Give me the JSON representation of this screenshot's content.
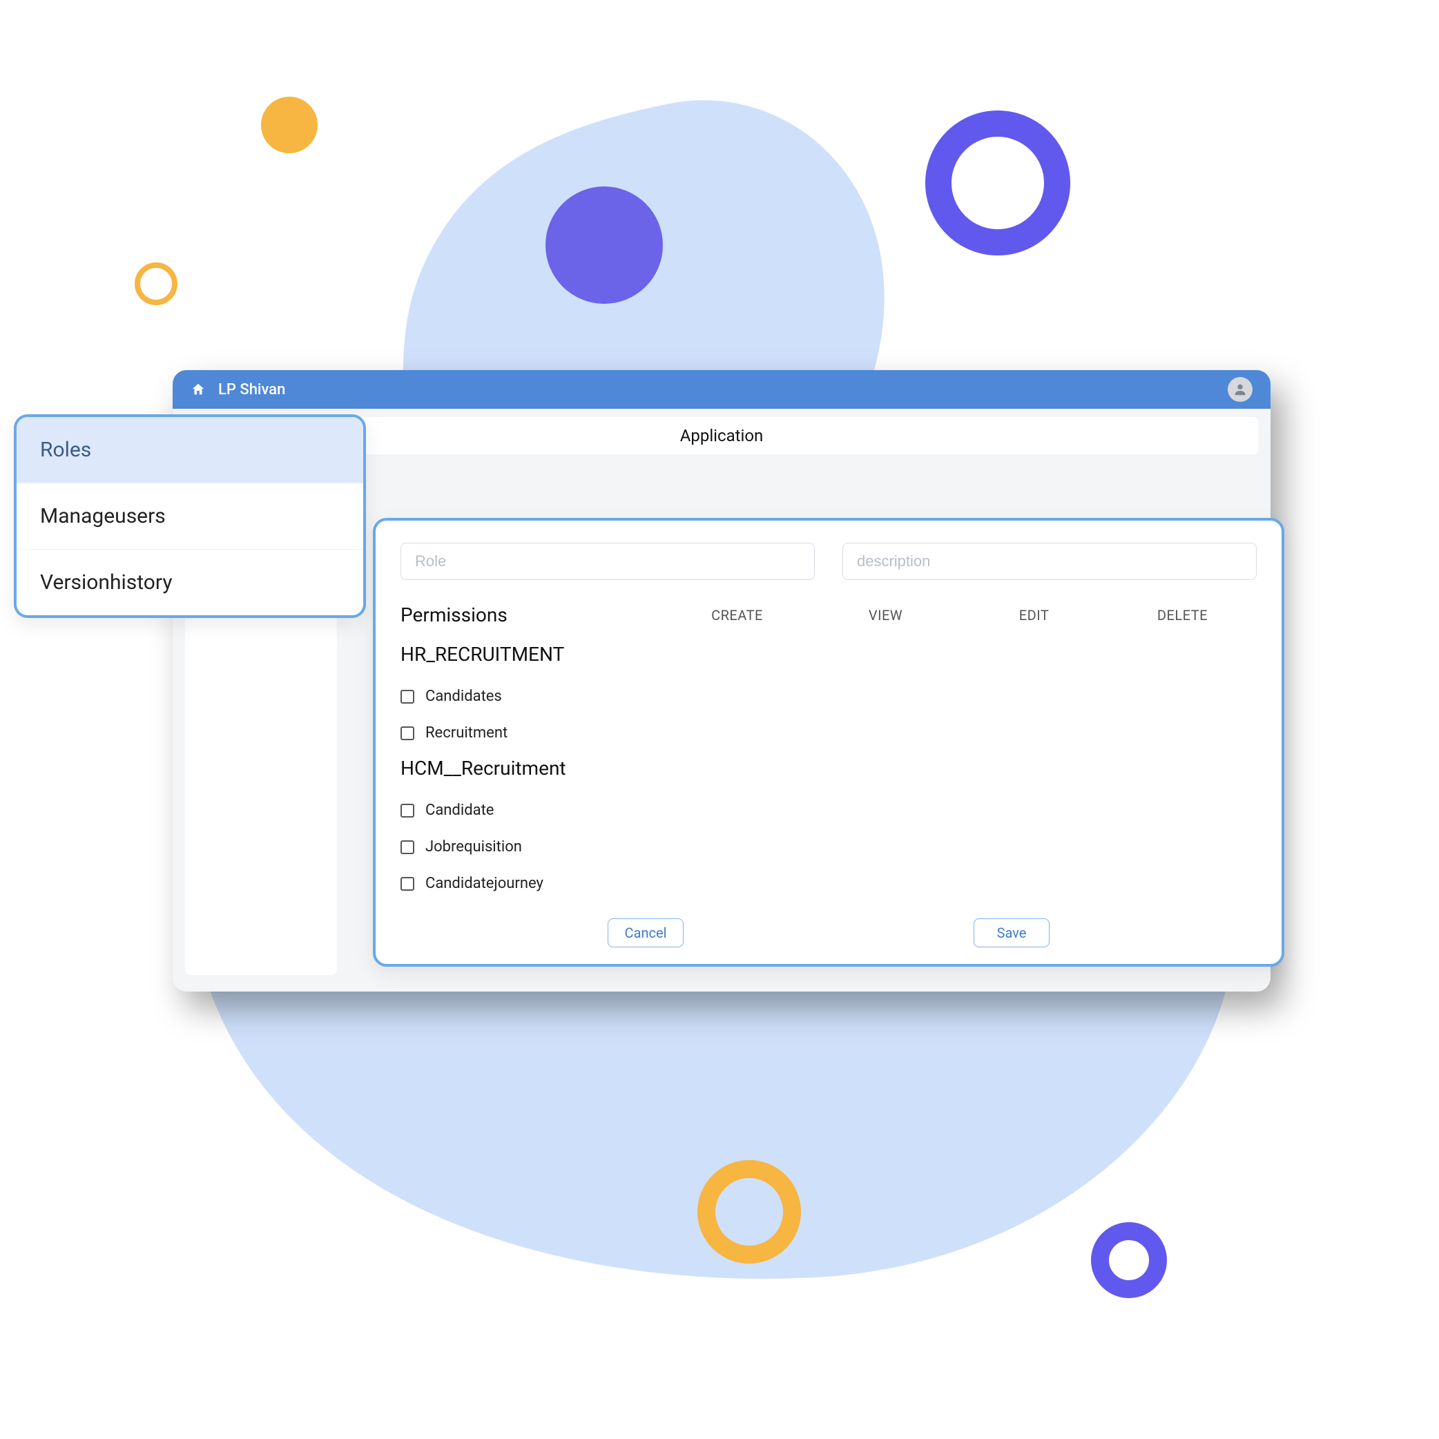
{
  "decor": {},
  "header": {
    "user_name": "LP Shivan",
    "subtitle": "Application"
  },
  "sidebar": {
    "items": [
      {
        "label": "Roles",
        "active": true
      },
      {
        "label": "Manageusers",
        "active": false
      },
      {
        "label": "Versionhistory",
        "active": false
      }
    ]
  },
  "form": {
    "role_placeholder": "Role",
    "description_placeholder": "description",
    "permissions_title": "Permissions",
    "columns": {
      "create": "CREATE",
      "view": "VIEW",
      "edit": "EDIT",
      "delete": "DELETE"
    },
    "groups": [
      {
        "title": "HR_RECRUITMENT",
        "items": [
          {
            "label": "Candidates"
          },
          {
            "label": "Recruitment"
          }
        ]
      },
      {
        "title": "HCM__Recruitment",
        "items": [
          {
            "label": "Candidate"
          },
          {
            "label": "Jobrequisition"
          },
          {
            "label": "Candidatejourney"
          }
        ]
      }
    ],
    "cancel_label": "Cancel",
    "save_label": "Save"
  }
}
